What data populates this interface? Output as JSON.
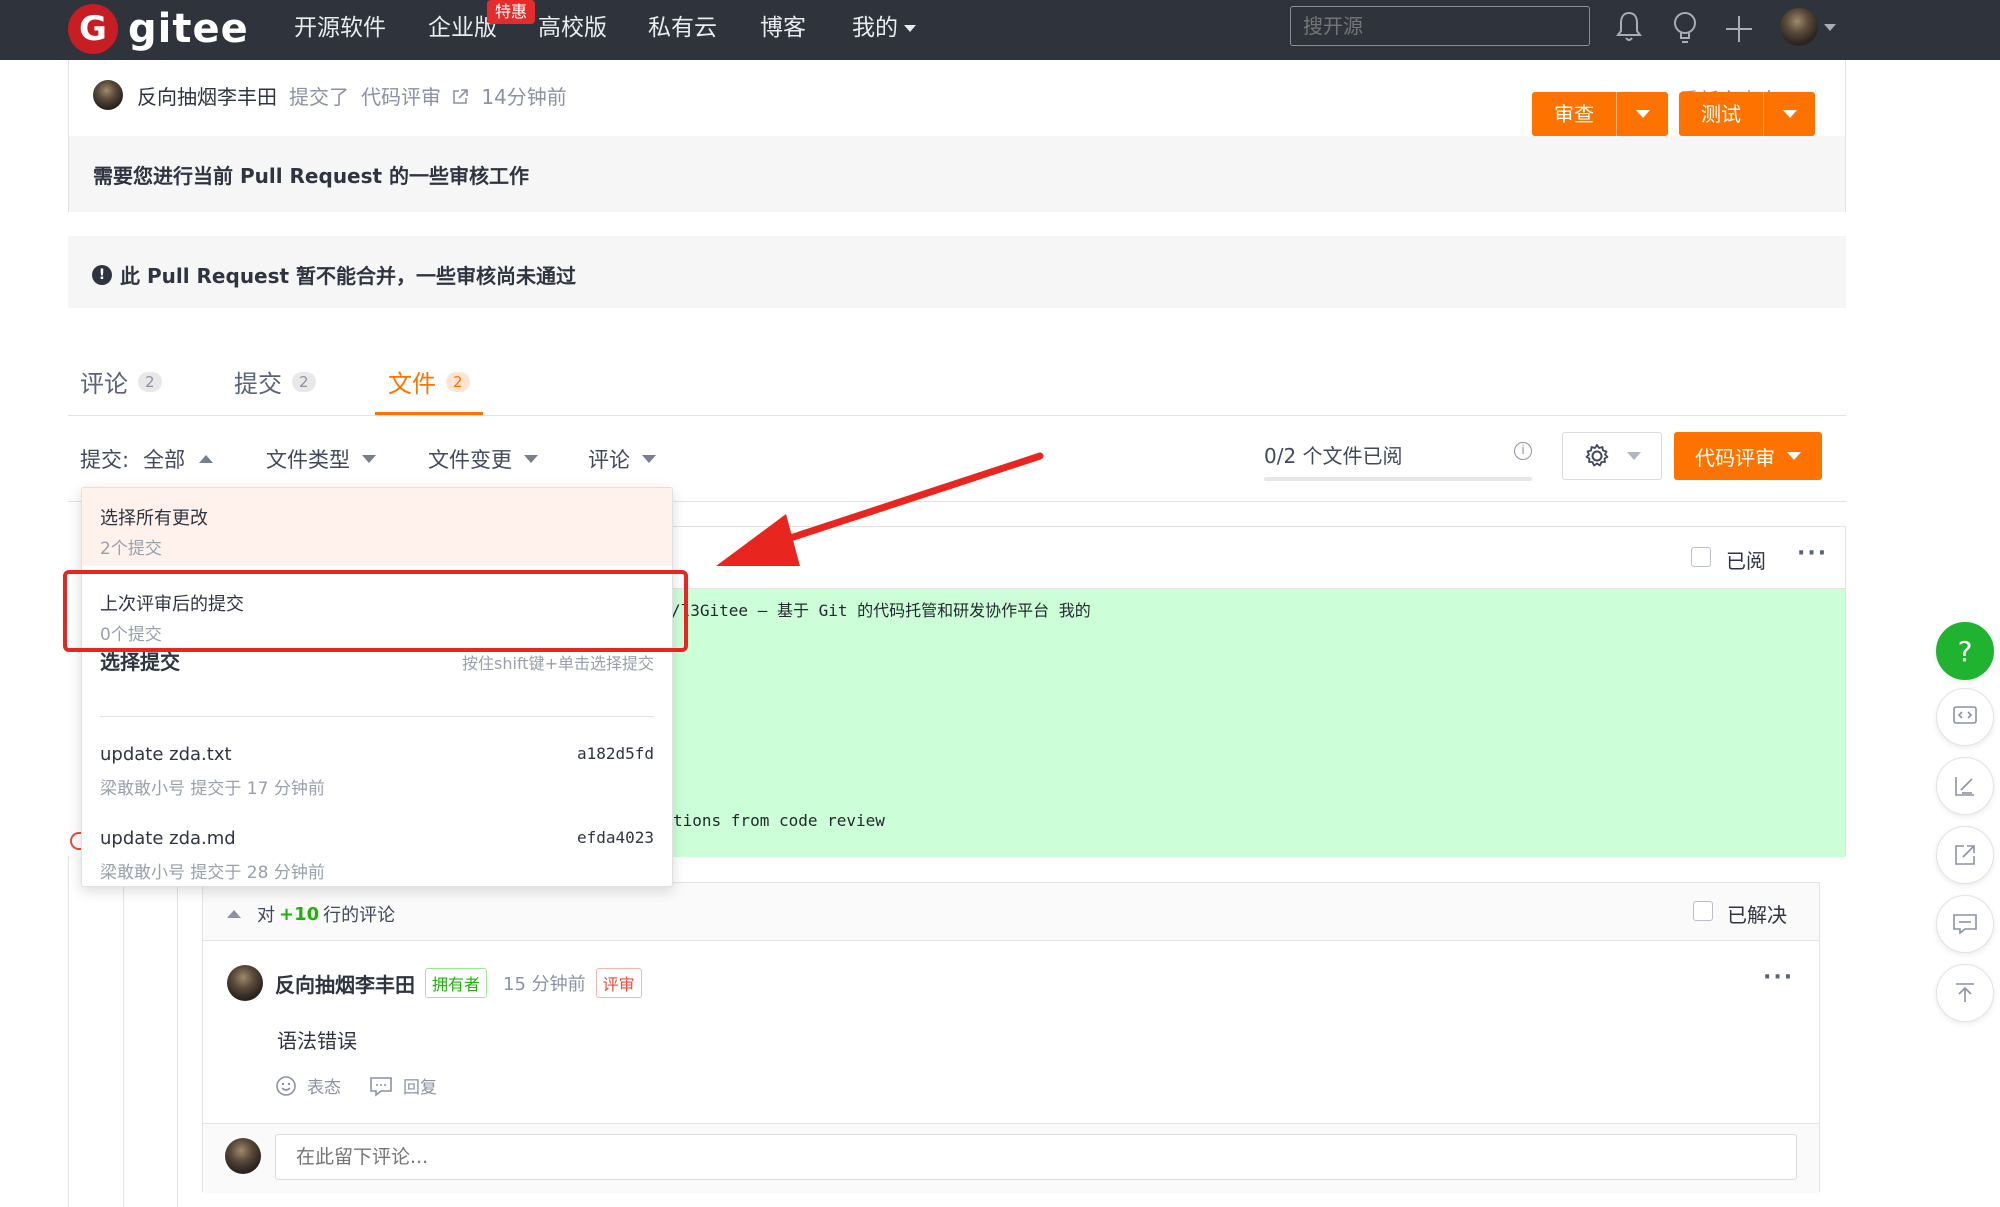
{
  "nav": {
    "brand": "gitee",
    "logo_letter": "G",
    "items": [
      "开源软件",
      "企业版",
      "高校版",
      "私有云",
      "博客",
      "我的"
    ],
    "enterprise_badge": "特惠",
    "search_placeholder": "搜开源"
  },
  "activity": {
    "author": "反向抽烟李丰田",
    "action": "提交了",
    "target": "代码评审",
    "time": "14分钟前",
    "status": "重新审查中"
  },
  "review_bar": {
    "message": "需要您进行当前 Pull Request 的一些审核工作",
    "review_label": "审查",
    "test_label": "测试"
  },
  "merge_notice": {
    "icon": "!",
    "message": "此 Pull Request 暂不能合并，一些审核尚未通过"
  },
  "tabs": [
    {
      "label": "评论",
      "count": "2"
    },
    {
      "label": "提交",
      "count": "2"
    },
    {
      "label": "文件",
      "count": "2"
    }
  ],
  "filters": {
    "commit_label": "提交:",
    "commit_value": "全部",
    "file_type": "文件类型",
    "file_change": "文件变更",
    "comment": "评论",
    "viewed_text": "0/2 个文件已阅",
    "viewed_fraction": 0,
    "code_review_label": "代码评审"
  },
  "dropdown": {
    "all_changes_title": "选择所有更改",
    "all_changes_sub": "2个提交",
    "since_review_title": "上次评审后的提交",
    "since_review_sub": "0个提交",
    "section_title": "选择提交",
    "section_hint": "按住shift键+单击选择提交",
    "commits": [
      {
        "title": "update zda.txt",
        "sha": "a182d5fd",
        "meta": "梁敢敢小号 提交于 17 分钟前"
      },
      {
        "title": "update zda.md",
        "sha": "efda4023",
        "meta": "梁敢敢小号 提交于 28 分钟前"
      }
    ]
  },
  "diff": {
    "viewed_label": "已阅",
    "line1": "/l3Gitee — 基于 Git 的代码托管和研发协作平台 我的",
    "line2": "tions from code review"
  },
  "thread": {
    "prefix": "对",
    "line_ref": "+10",
    "suffix": "行的评论",
    "resolved_label": "已解决",
    "author": "反向抽烟李丰田",
    "owner_tag": "拥有者",
    "time": "15 分钟前",
    "review_tag": "评审",
    "body": "语法错误",
    "react_label": "表态",
    "reply_label": "回复",
    "reply_placeholder": "在此留下评论..."
  },
  "float_tools": {
    "help": "?"
  },
  "colors": {
    "accent": "#fe7300",
    "nav_bg": "#2f343c",
    "diff_added": "#ccffd8",
    "annotation_red": "#e8261f",
    "help_green": "#1fb32f"
  }
}
